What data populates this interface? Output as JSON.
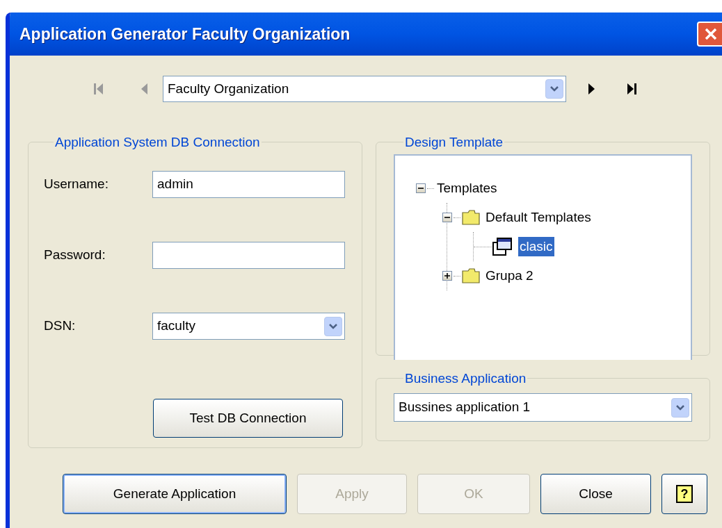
{
  "window": {
    "title": "Application Generator Faculty Organization"
  },
  "navigator": {
    "value": "Faculty Organization"
  },
  "db_connection": {
    "title": "Application System DB Connection",
    "fields": [
      {
        "kind": "text",
        "label": "Username:",
        "value": "admin"
      },
      {
        "kind": "text",
        "label": "Password:"
      },
      {
        "kind": "select",
        "label": "DSN:",
        "value": "faculty"
      }
    ],
    "test_button": "Test DB Connection"
  },
  "design_template": {
    "title": "Design Template",
    "tree": [
      {
        "label": "Templates",
        "expanded": true,
        "selected": false,
        "children": [
          {
            "label": "Default Templates",
            "kind": "folder",
            "expanded": true,
            "selected": false,
            "children": [
              {
                "label": "clasic",
                "kind": "template",
                "selected": true
              }
            ]
          },
          {
            "label": "Grupa 2",
            "kind": "folder",
            "expanded": false,
            "selected": false
          }
        ]
      }
    ]
  },
  "business_application": {
    "title": "Business Application",
    "value": "Bussines application 1"
  },
  "buttons": [
    {
      "label": "Generate Application",
      "disabled": false,
      "default": true
    },
    {
      "label": "Apply",
      "disabled": true,
      "default": false
    },
    {
      "label": "OK",
      "disabled": true,
      "default": false
    },
    {
      "label": "Close",
      "disabled": false,
      "default": false
    }
  ],
  "help_button": {
    "label": "?"
  }
}
